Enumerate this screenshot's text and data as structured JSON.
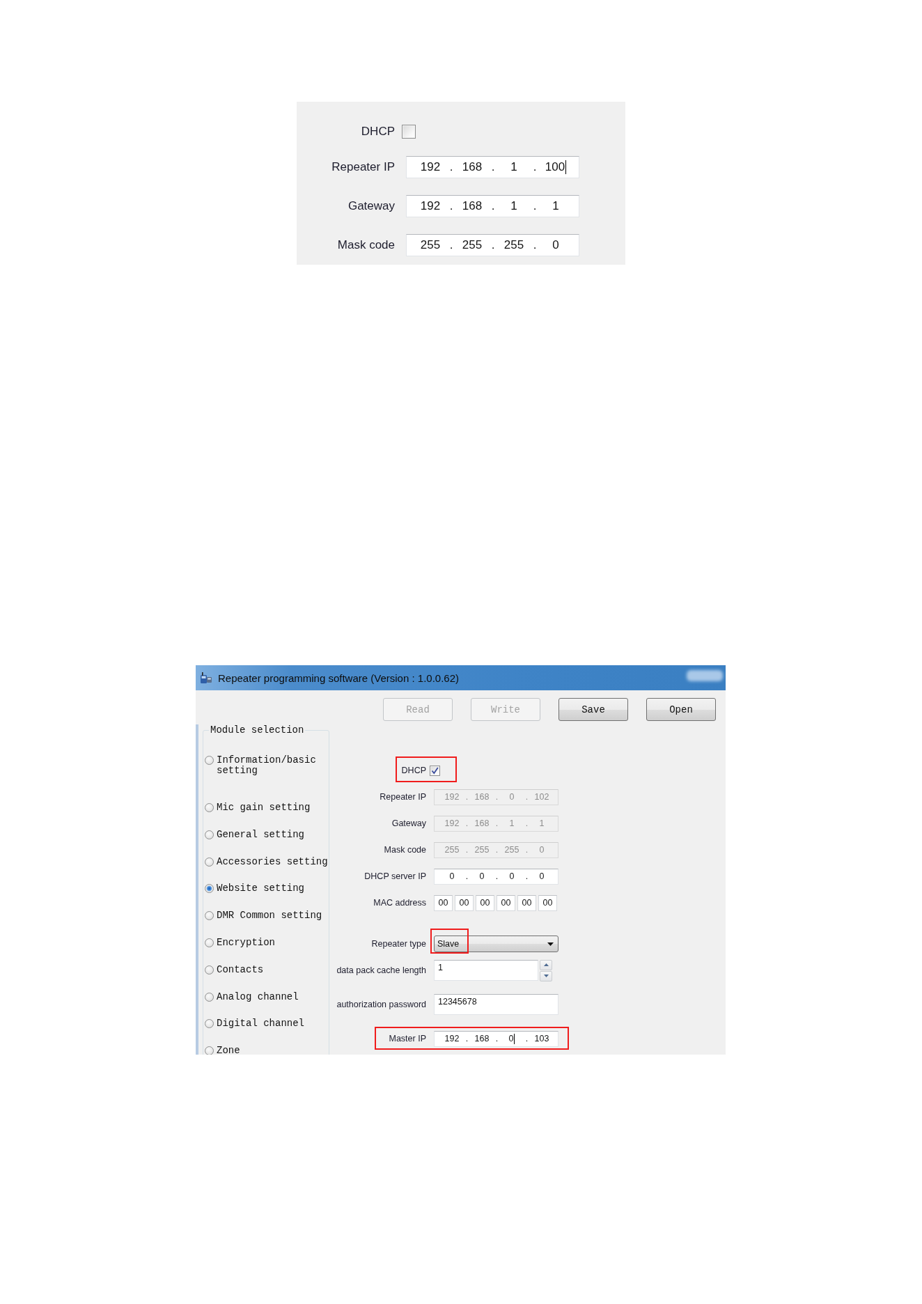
{
  "top_panel": {
    "dhcp": {
      "label": "DHCP",
      "checked": false
    },
    "fields": [
      {
        "label": "Repeater IP",
        "separator": ".",
        "octets": [
          {
            "value": "192",
            "caret": false
          },
          {
            "value": "168",
            "caret": false
          },
          {
            "value": "1",
            "caret": false
          },
          {
            "value": "100",
            "caret": true
          }
        ]
      },
      {
        "label": "Gateway",
        "separator": ".",
        "octets": [
          {
            "value": "192",
            "caret": false
          },
          {
            "value": "168",
            "caret": false
          },
          {
            "value": "1",
            "caret": false
          },
          {
            "value": "1",
            "caret": false
          }
        ]
      },
      {
        "label": "Mask code",
        "separator": ".",
        "octets": [
          {
            "value": "255",
            "caret": false
          },
          {
            "value": "255",
            "caret": false
          },
          {
            "value": "255",
            "caret": false
          },
          {
            "value": "0",
            "caret": false
          }
        ]
      }
    ]
  },
  "window": {
    "title": "Repeater programming software (Version : 1.0.0.62)",
    "toolbar": [
      {
        "label": "Read",
        "disabled": true
      },
      {
        "label": "Write",
        "disabled": true
      },
      {
        "label": "Save",
        "disabled": false
      },
      {
        "label": "Open",
        "disabled": false
      }
    ],
    "module_selection": {
      "title": "Module selection",
      "items": [
        {
          "label": "Information/basic setting",
          "selected": false
        },
        {
          "label": "Mic gain setting",
          "selected": false
        },
        {
          "label": "General setting",
          "selected": false
        },
        {
          "label": "Accessories setting",
          "selected": false
        },
        {
          "label": "Website setting",
          "selected": true
        },
        {
          "label": "DMR Common setting",
          "selected": false
        },
        {
          "label": "Encryption",
          "selected": false
        },
        {
          "label": "Contacts",
          "selected": false
        },
        {
          "label": "Analog channel",
          "selected": false
        },
        {
          "label": "Digital channel",
          "selected": false
        },
        {
          "label": "Zone",
          "selected": false
        }
      ]
    },
    "form": {
      "rows": [
        {
          "kind": "checkbox",
          "label": "DHCP",
          "checked": true,
          "highlighted": true
        },
        {
          "kind": "ip",
          "label": "Repeater IP",
          "disabled": true,
          "highlighted": false,
          "separator": ".",
          "octets": [
            {
              "value": "192",
              "caret": false
            },
            {
              "value": "168",
              "caret": false
            },
            {
              "value": "0",
              "caret": false
            },
            {
              "value": "102",
              "caret": false
            }
          ]
        },
        {
          "kind": "ip",
          "label": "Gateway",
          "disabled": true,
          "highlighted": false,
          "separator": ".",
          "octets": [
            {
              "value": "192",
              "caret": false
            },
            {
              "value": "168",
              "caret": false
            },
            {
              "value": "1",
              "caret": false
            },
            {
              "value": "1",
              "caret": false
            }
          ]
        },
        {
          "kind": "ip",
          "label": "Mask code",
          "disabled": true,
          "highlighted": false,
          "separator": ".",
          "octets": [
            {
              "value": "255",
              "caret": false
            },
            {
              "value": "255",
              "caret": false
            },
            {
              "value": "255",
              "caret": false
            },
            {
              "value": "0",
              "caret": false
            }
          ]
        },
        {
          "kind": "ip",
          "label": "DHCP server IP",
          "disabled": false,
          "highlighted": false,
          "separator": ".",
          "octets": [
            {
              "value": "0",
              "caret": false
            },
            {
              "value": "0",
              "caret": false
            },
            {
              "value": "0",
              "caret": false
            },
            {
              "value": "0",
              "caret": false
            }
          ]
        },
        {
          "kind": "mac",
          "label": "MAC address",
          "highlighted": false,
          "bytes": [
            "00",
            "00",
            "00",
            "00",
            "00",
            "00"
          ]
        },
        {
          "kind": "dropdown",
          "label": "Repeater type",
          "value": "Slave",
          "highlighted": true
        },
        {
          "kind": "spinner",
          "label": "data pack cache length",
          "value": "1",
          "highlighted": false
        },
        {
          "kind": "text",
          "label": "authorization password",
          "value": "12345678",
          "highlighted": false
        },
        {
          "kind": "ip",
          "label": "Master IP",
          "disabled": false,
          "highlighted": true,
          "separator": ".",
          "octets": [
            {
              "value": "192",
              "caret": false
            },
            {
              "value": "168",
              "caret": false
            },
            {
              "value": "0",
              "caret": true
            },
            {
              "value": "103",
              "caret": false
            }
          ]
        }
      ]
    }
  }
}
